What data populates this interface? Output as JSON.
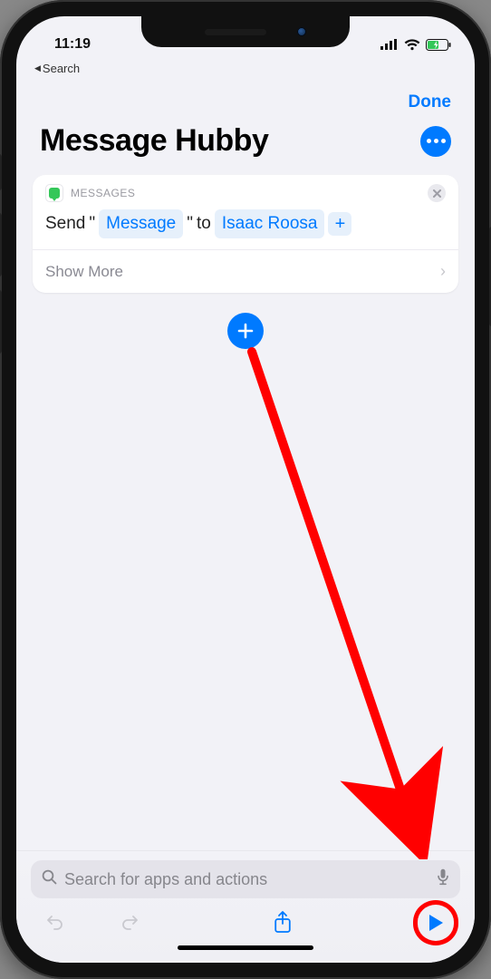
{
  "status": {
    "time": "11:19"
  },
  "back": {
    "label": "Search"
  },
  "header": {
    "done": "Done"
  },
  "title": "Message Hubby",
  "action_card": {
    "app_label": "MESSAGES",
    "verb_prefix": "Send",
    "quote_open": "\"",
    "message_token": "Message",
    "quote_close": "\"",
    "to_word": "to",
    "recipient": "Isaac Roosa",
    "plus": "+",
    "show_more": "Show More"
  },
  "search": {
    "placeholder": "Search for apps and actions"
  }
}
